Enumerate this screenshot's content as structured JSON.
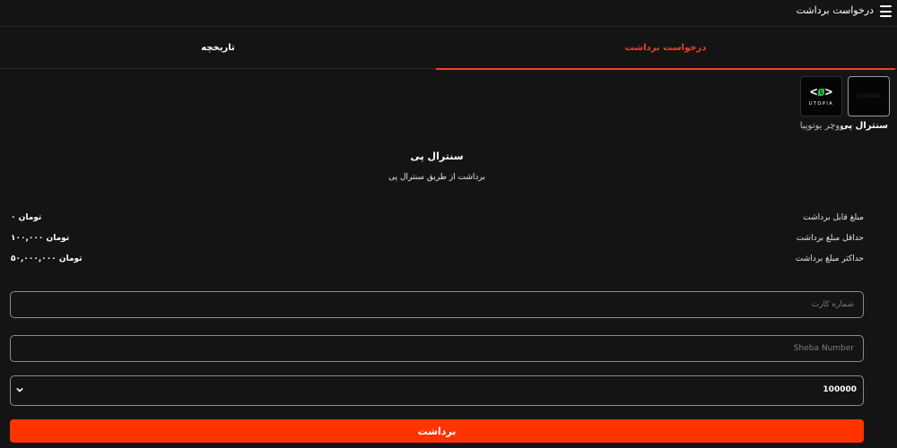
{
  "header": {
    "title": "درخواست برداشت",
    "menu_icon": "hamburger-menu-icon"
  },
  "tabs": [
    {
      "label": "درخواست برداشت",
      "active": true
    },
    {
      "label": "تاریخچه",
      "active": false
    }
  ],
  "methods": [
    {
      "label": "سنترال پی",
      "active": true,
      "logo_text": "CENTRAL"
    },
    {
      "label": "ووچر یوتوپیا",
      "active": false,
      "logo_mark_left": "<",
      "logo_mark_mid": "ø",
      "logo_mark_right": ">",
      "logo_text": "UTOPIA"
    }
  ],
  "section": {
    "title": "سنترال پی",
    "subtitle": "برداشت از طریق سنترال پی"
  },
  "info": [
    {
      "label": "مبلغ قابل برداشت",
      "value": "۰ تومان"
    },
    {
      "label": "حداقل مبلغ برداشت",
      "value": "۱۰۰,۰۰۰ تومان"
    },
    {
      "label": "حداکثر مبلغ برداشت",
      "value": "۵۰,۰۰۰,۰۰۰ تومان"
    }
  ],
  "form": {
    "card_placeholder": "شماره کارت",
    "sheba_placeholder": "Sheba Number",
    "amount_selected": "100000",
    "submit_label": "برداشت"
  },
  "colors": {
    "accent": "#ff3300",
    "tab_active": "#ff3b1f",
    "background": "#141414"
  }
}
